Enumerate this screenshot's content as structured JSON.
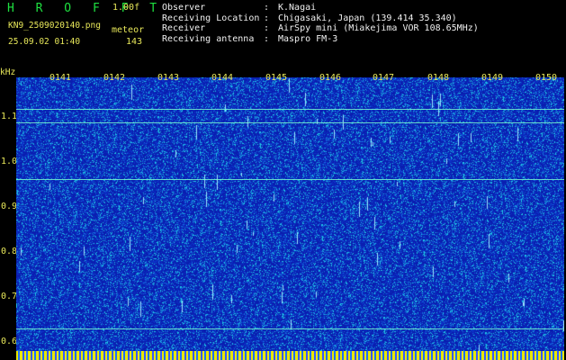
{
  "app": {
    "logo": "H R O F F T",
    "version": "1.00f",
    "filename": "KN9_2509020140.png",
    "meteor_label": "meteor",
    "datetime": "25.09.02 01:40",
    "meteor_count": "143"
  },
  "info": {
    "rows": [
      {
        "key": "Observer",
        "value": "K.Nagai"
      },
      {
        "key": "Receiving Location",
        "value": "Chigasaki, Japan (139.414 35.340)"
      },
      {
        "key": "Receiver",
        "value": "AirSpy mini (Miakejima VOR 108.65MHz)"
      },
      {
        "key": "Receiving antenna",
        "value": "Maspro FM-3"
      }
    ]
  },
  "chart_data": {
    "type": "heatmap",
    "ylabel": "kHz",
    "yticks": [
      "1.1",
      "1.0",
      "0.9",
      "0.8",
      "0.7",
      "0.6"
    ],
    "xticks": [
      "0141",
      "0142",
      "0143",
      "0144",
      "0145",
      "0146",
      "0147",
      "0148",
      "0149",
      "0150"
    ],
    "horizontal_lines_khz": [
      1.106,
      1.076,
      0.95,
      0.618
    ],
    "colors": {
      "background": "#0a1eb0",
      "noise": "#1ec8e6",
      "signal": "#9ce8ff",
      "line": "#7cffd0"
    }
  }
}
